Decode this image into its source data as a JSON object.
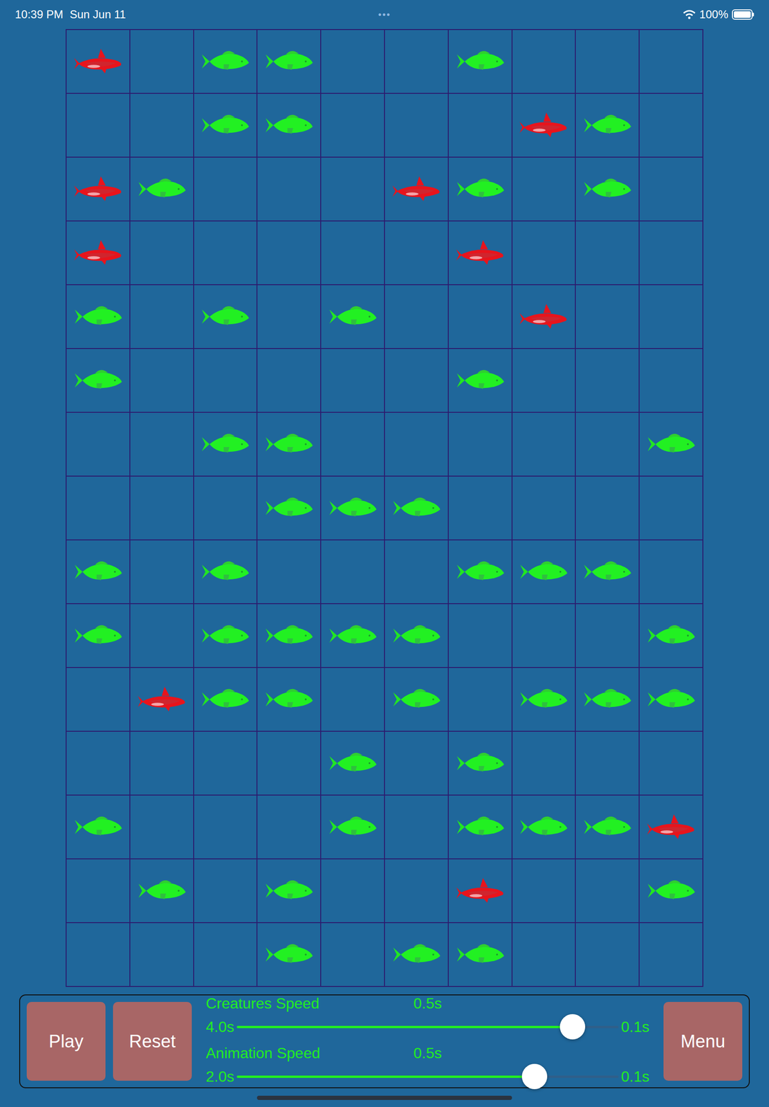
{
  "status_bar": {
    "time": "10:39 PM",
    "date": "Sun Jun 11",
    "menu_dots": "•••",
    "battery": "100%"
  },
  "grid": {
    "rows": [
      [
        "shark",
        "",
        "fish",
        "fish",
        "",
        "",
        "fish",
        "",
        "",
        ""
      ],
      [
        "",
        "",
        "fish",
        "fish",
        "",
        "",
        "",
        "shark",
        "fish",
        ""
      ],
      [
        "shark",
        "fish",
        "",
        "",
        "",
        "shark",
        "fish",
        "",
        "fish",
        ""
      ],
      [
        "shark",
        "",
        "",
        "",
        "",
        "",
        "shark",
        "",
        "",
        ""
      ],
      [
        "fish",
        "",
        "fish",
        "",
        "fish",
        "",
        "",
        "shark",
        "",
        ""
      ],
      [
        "fish",
        "",
        "",
        "",
        "",
        "",
        "fish",
        "",
        "",
        ""
      ],
      [
        "",
        "",
        "fish",
        "fish",
        "",
        "",
        "",
        "",
        "",
        "fish"
      ],
      [
        "",
        "",
        "",
        "fish",
        "fish",
        "fish",
        "",
        "",
        "",
        ""
      ],
      [
        "fish",
        "",
        "fish",
        "",
        "",
        "",
        "fish",
        "fish",
        "fish",
        ""
      ],
      [
        "fish",
        "",
        "fish",
        "fish",
        "fish",
        "fish",
        "",
        "",
        "",
        "fish"
      ],
      [
        "",
        "shark",
        "fish",
        "fish",
        "",
        "fish",
        "",
        "fish",
        "fish",
        "fish"
      ],
      [
        "",
        "",
        "",
        "",
        "fish",
        "",
        "fish",
        "",
        "",
        ""
      ],
      [
        "fish",
        "",
        "",
        "",
        "fish",
        "",
        "fish",
        "fish",
        "fish",
        "shark"
      ],
      [
        "",
        "fish",
        "",
        "fish",
        "",
        "",
        "shark",
        "",
        "",
        "fish"
      ],
      [
        "",
        "",
        "",
        "fish",
        "",
        "fish",
        "fish",
        "",
        "",
        ""
      ]
    ]
  },
  "controls": {
    "buttons": [
      "Play",
      "Reset"
    ],
    "menu_button": "Menu",
    "sliders": [
      {
        "label": "Creatures Speed",
        "value": "0.5s",
        "min_label": "4.0s",
        "max_label": "0.1s",
        "level": 0.88
      },
      {
        "label": "Animation Speed",
        "value": "0.5s",
        "min_label": "2.0s",
        "max_label": "0.1s",
        "level": 0.78
      }
    ]
  }
}
